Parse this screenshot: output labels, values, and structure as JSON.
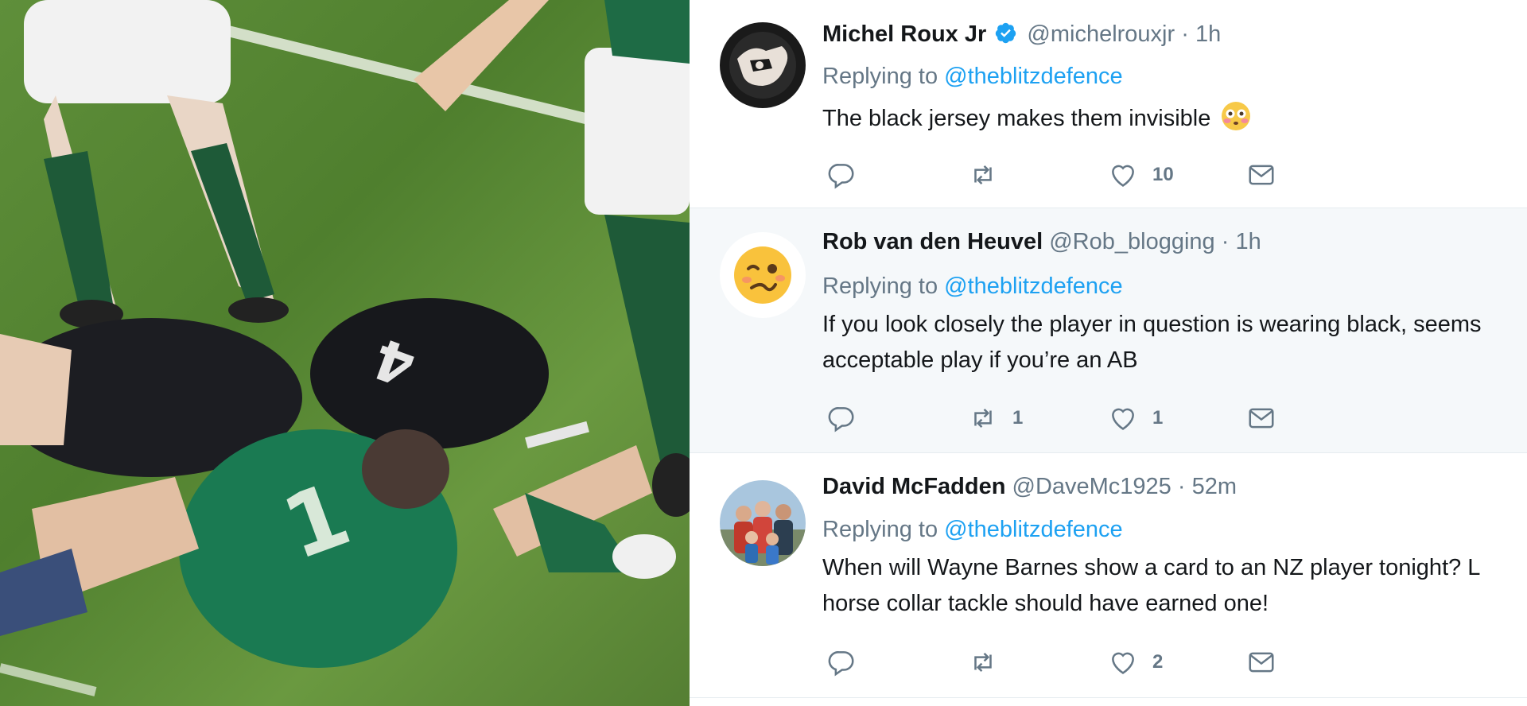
{
  "media": {
    "description_icon": "rugby-video-still",
    "jersey_numbers": [
      "4",
      "1"
    ]
  },
  "replies": [
    {
      "name": "Michel Roux Jr",
      "verified": true,
      "handle": "@michelrouxjr",
      "separator": "·",
      "time": "1h",
      "replying_prefix": "Replying to",
      "replying_to": "@theblitzdefence",
      "text_lines": [
        "The black jersey makes them invisible"
      ],
      "text_emoji": "flushed-face-emoji",
      "avatar_icon": "michel-roux-avatar",
      "reply_count": "",
      "retweet_count": "",
      "like_count": "10"
    },
    {
      "name": "Rob van den Heuvel",
      "verified": false,
      "handle": "@Rob_blogging",
      "separator": "·",
      "time": "1h",
      "replying_prefix": "Replying to",
      "replying_to": "@theblitzdefence",
      "text_lines": [
        "If you look closely the player in question is wearing black, seems",
        "acceptable play if you’re an AB"
      ],
      "avatar_icon": "woozy-face-avatar",
      "reply_count": "",
      "retweet_count": "1",
      "like_count": "1"
    },
    {
      "name": "David McFadden",
      "verified": false,
      "handle": "@DaveMc1925",
      "separator": "·",
      "time": "52m",
      "replying_prefix": "Replying to",
      "replying_to": "@theblitzdefence",
      "text_lines": [
        "When will Wayne Barnes show a card to an NZ player tonight? L",
        "horse collar tackle should have earned one!"
      ],
      "avatar_icon": "family-photo-avatar",
      "reply_count": "",
      "retweet_count": "",
      "like_count": "2"
    }
  ],
  "colors": {
    "link": "#1da1f2",
    "muted": "#657786",
    "text": "#14171a",
    "divider": "#e6ecf0"
  }
}
